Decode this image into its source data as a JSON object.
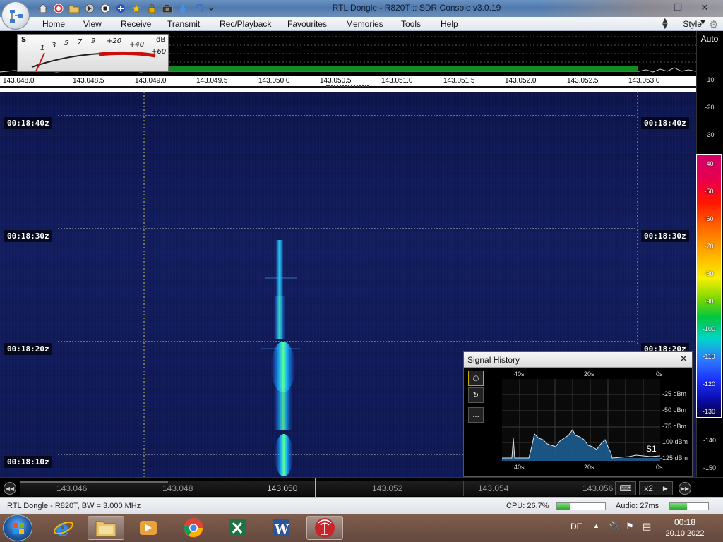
{
  "window": {
    "title": "RTL Dongle - R820T :: SDR Console v3.0.19"
  },
  "ribbon": {
    "tabs": [
      "Home",
      "View",
      "Receive",
      "Transmit",
      "Rec/Playback",
      "Favourites",
      "Memories",
      "Tools",
      "Help"
    ],
    "style_label": "Style"
  },
  "smeter": {
    "s_label": "S",
    "db_label": "dB",
    "s_scale": [
      "1",
      "3",
      "5",
      "7",
      "9"
    ],
    "plus_scale": [
      "+20",
      "+40",
      "+60"
    ]
  },
  "spectrum": {
    "auto_label": "Auto",
    "freq_labels": [
      "143.048.0",
      "143.048.5",
      "143.049.0",
      "143.049.5",
      "143.050.0",
      "143.050.5",
      "143.051.0",
      "143.051.5",
      "143.052.0",
      "143.052.5",
      "143.053.0"
    ],
    "db_ticks": [
      "-10",
      "-20",
      "-30"
    ]
  },
  "colorscale": {
    "labels": [
      "-40",
      "-50",
      "-60",
      "-70",
      "-80",
      "-90",
      "-100",
      "-110",
      "-120",
      "-130"
    ],
    "lower_ticks": [
      "-140",
      "-150"
    ]
  },
  "waterfall": {
    "time_labels": [
      "00:18:40z",
      "00:18:30z",
      "00:18:20z",
      "00:18:10z"
    ]
  },
  "signal_history": {
    "title": "Signal History",
    "top_time": [
      "40s",
      "20s",
      "0s"
    ],
    "bottom_time": [
      "40s",
      "20s",
      "0s"
    ],
    "dbm_labels": [
      "-25 dBm",
      "-50 dBm",
      "-75 dBm",
      "-100 dBm",
      "-125 dBm"
    ],
    "s_reading": "S1",
    "buttons": [
      "circle-icon",
      "refresh-icon",
      "more-icon"
    ],
    "more_label": "..."
  },
  "tuning": {
    "freq_labels": [
      "143.046",
      "143.048",
      "143.050",
      "143.052",
      "143.054",
      "143.056"
    ],
    "zoom_label": "x2"
  },
  "status": {
    "device": "RTL Dongle - R820T, BW = 3.000 MHz",
    "cpu": "CPU: 26.7%",
    "cpu_value": 0.267,
    "audio": "Audio: 27ms",
    "audio_value": 0.45
  },
  "taskbar": {
    "apps": [
      "internet-explorer-icon",
      "file-explorer-icon",
      "media-player-icon",
      "chrome-icon",
      "excel-icon",
      "word-icon",
      "sdr-console-icon"
    ],
    "language": "DE",
    "time": "00:18",
    "date": "20.10.2022"
  },
  "colors": {
    "accent": "#4f79ad",
    "signal": "#2ee87a",
    "waterfall_bg": "#0c1448"
  }
}
